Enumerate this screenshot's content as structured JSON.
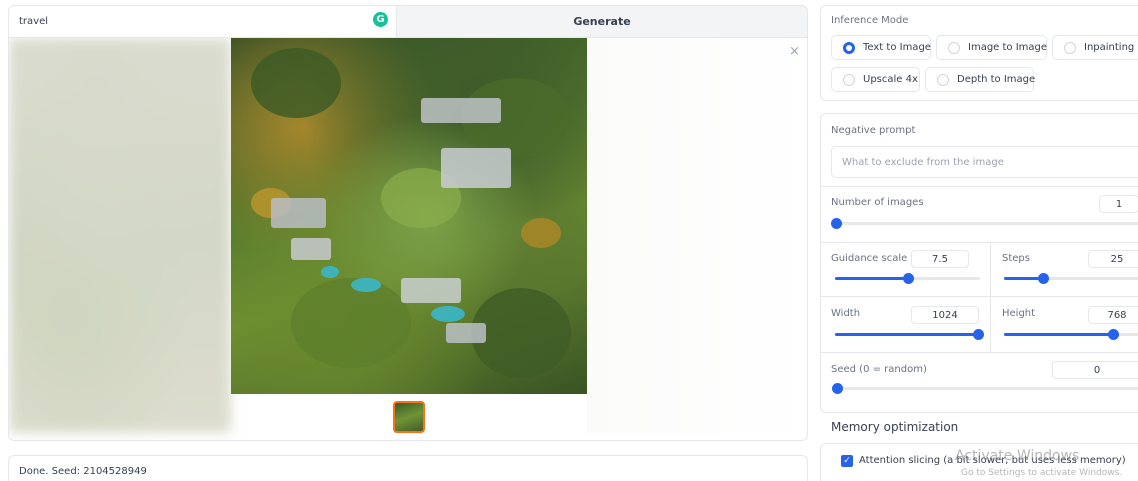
{
  "prompt": {
    "value": "travel",
    "grammarly_glyph": "G"
  },
  "generate_label": "Generate",
  "gallery": {
    "close_glyph": "×"
  },
  "status": {
    "text": "Done. Seed: 2104528949"
  },
  "inference": {
    "label": "Inference Mode",
    "options": [
      "Text to Image",
      "Image to Image",
      "Inpainting",
      "Upscale 4x",
      "Depth to Image"
    ],
    "selected": "Text to Image"
  },
  "negative_prompt": {
    "label": "Negative prompt",
    "placeholder": "What to exclude from the image"
  },
  "num_images": {
    "label": "Number of images",
    "value": "1",
    "fraction": 0.0
  },
  "guidance": {
    "label": "Guidance scale",
    "value": "7.5",
    "fraction": 0.5
  },
  "steps": {
    "label": "Steps",
    "value": "25",
    "fraction": 0.27
  },
  "width": {
    "label": "Width",
    "value": "1024",
    "fraction": 1.0
  },
  "height": {
    "label": "Height",
    "value": "768",
    "fraction": 0.75
  },
  "seed": {
    "label": "Seed (0 = random)",
    "value": "0",
    "fraction": 0.0
  },
  "memory": {
    "title": "Memory optimization",
    "attention_slicing": {
      "label": "Attention slicing (a bit slower, but uses less memory)",
      "checked": true
    }
  },
  "os_watermark": {
    "line1": "Activate Windows",
    "line2": "Go to Settings to activate Windows."
  },
  "colors": {
    "accent": "#2563eb",
    "thumbnail_border": "#f97316",
    "grammarly": "#15c39a"
  }
}
